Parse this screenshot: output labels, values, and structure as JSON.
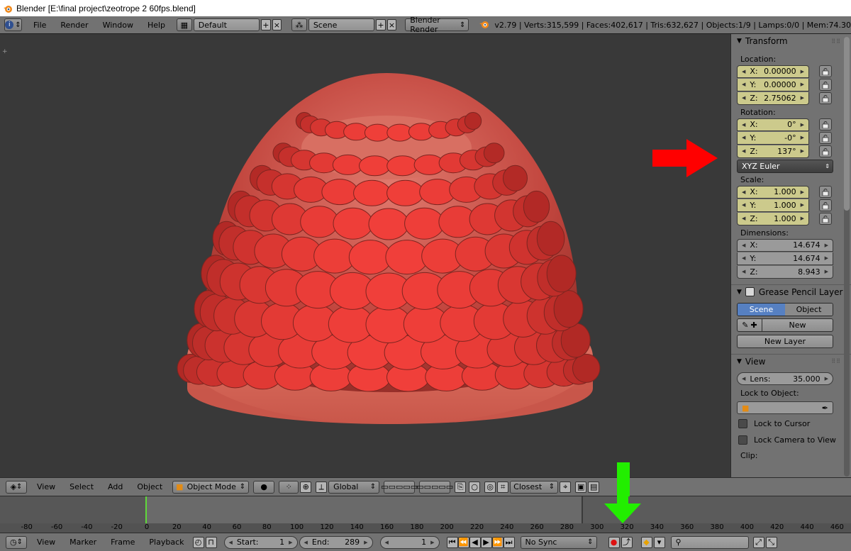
{
  "titlebar": {
    "title": "Blender [E:\\final project\\zeotrope 2 60fps.blend]"
  },
  "infobar": {
    "menus": [
      "File",
      "Render",
      "Window",
      "Help"
    ],
    "screen_layout": "Default",
    "scene": "Scene",
    "render_engine": "Blender Render",
    "stats": "v2.79 | Verts:315,599 | Faces:402,617 | Tris:632,627 | Objects:1/9 | Lamps:0/0 | Mem:74.30"
  },
  "npanel": {
    "transform": {
      "title": "Transform",
      "location_label": "Location:",
      "location": [
        {
          "axis": "X:",
          "value": "0.00000"
        },
        {
          "axis": "Y:",
          "value": "0.00000"
        },
        {
          "axis": "Z:",
          "value": "2.75062"
        }
      ],
      "rotation_label": "Rotation:",
      "rotation": [
        {
          "axis": "X:",
          "value": "0°"
        },
        {
          "axis": "Y:",
          "value": "-0°"
        },
        {
          "axis": "Z:",
          "value": "137°"
        }
      ],
      "rotation_mode": "XYZ Euler",
      "scale_label": "Scale:",
      "scale": [
        {
          "axis": "X:",
          "value": "1.000"
        },
        {
          "axis": "Y:",
          "value": "1.000"
        },
        {
          "axis": "Z:",
          "value": "1.000"
        }
      ],
      "dimensions_label": "Dimensions:",
      "dimensions": [
        {
          "axis": "X:",
          "value": "14.674"
        },
        {
          "axis": "Y:",
          "value": "14.674"
        },
        {
          "axis": "Z:",
          "value": "8.943"
        }
      ]
    },
    "grease_pencil": {
      "title": "Grease Pencil Layer",
      "tab_scene": "Scene",
      "tab_object": "Object",
      "new_label": "New",
      "new_layer_label": "New Layer"
    },
    "view": {
      "title": "View",
      "lens_label": "Lens:",
      "lens_value": "35.000",
      "lock_to_object_label": "Lock to Object:",
      "lock_to_cursor": "Lock to Cursor",
      "lock_camera_to_view": "Lock Camera to View",
      "clip_label": "Clip:"
    }
  },
  "view3d_header": {
    "menus": [
      "View",
      "Select",
      "Add",
      "Object"
    ],
    "mode": "Object Mode",
    "orientation": "Global",
    "snap_target": "Closest"
  },
  "timeline": {
    "ticks": [
      "-80",
      "-60",
      "-40",
      "-20",
      "0",
      "20",
      "40",
      "60",
      "80",
      "100",
      "120",
      "140",
      "160",
      "180",
      "200",
      "220",
      "240",
      "260",
      "280",
      "300",
      "320",
      "340",
      "360",
      "380",
      "400",
      "420",
      "440",
      "460"
    ],
    "menus": [
      "View",
      "Marker",
      "Frame",
      "Playback"
    ],
    "start_label": "Start:",
    "start_value": "1",
    "end_label": "End:",
    "end_value": "289",
    "current_frame": "1",
    "sync": "No Sync"
  },
  "colors": {
    "object_fill": "#d96a5e",
    "annotation_red_arrow": "#ff0000",
    "annotation_green_arrow": "#22ee00",
    "current_frame_marker": "#5fd93a",
    "keyed_field": "#ccca8c",
    "selected_tab": "#5680c2"
  }
}
